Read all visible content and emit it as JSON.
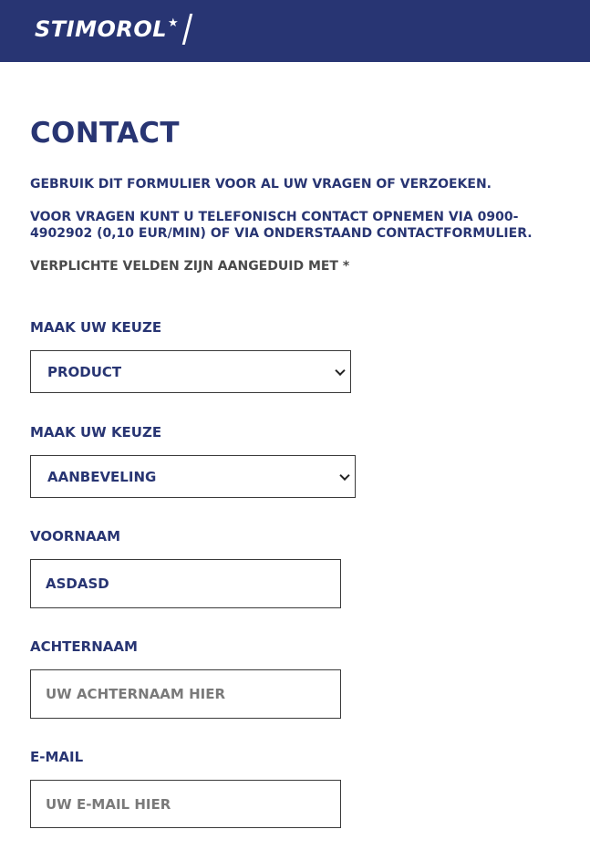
{
  "header": {
    "logo_text": "STIMOROL",
    "logo_star": "★",
    "bg_color": "#283573"
  },
  "page": {
    "title": "CONTACT",
    "intro_1": "GEBRUIK DIT FORMULIER VOOR AL UW VRAGEN OF VERZOEKEN.",
    "intro_2": "VOOR VRAGEN KUNT U TELEFONISCH CONTACT OPNEMEN VIA 0900-4902902 (0,10 EUR/MIN) OF VIA ONDERSTAAND CONTACTFORMULIER.",
    "required_note": "VERPLICHTE VELDEN ZIJN AANGEDUID MET *"
  },
  "form": {
    "choice_1": {
      "label": "MAAK UW KEUZE",
      "selected": "PRODUCT"
    },
    "choice_2": {
      "label": "MAAK UW KEUZE",
      "selected": "AANBEVELING"
    },
    "first_name": {
      "label": "VOORNAAM",
      "value": "ASDASD",
      "placeholder": ""
    },
    "last_name": {
      "label": "ACHTERNAAM",
      "value": "",
      "placeholder": "UW ACHTERNAAM HIER"
    },
    "email": {
      "label": "E-MAIL",
      "value": "",
      "placeholder": "UW E-MAIL HIER"
    }
  },
  "colors": {
    "brand": "#283573",
    "text_gray": "#4a4a4a",
    "placeholder_gray": "#7a7a7a"
  }
}
